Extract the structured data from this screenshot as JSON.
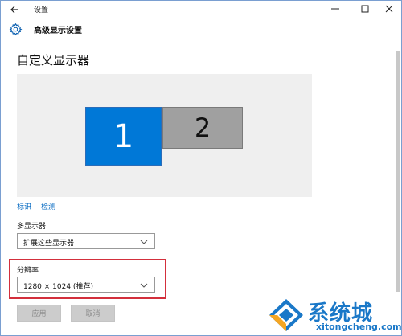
{
  "window": {
    "title": "设置",
    "icons": {
      "back": "back-arrow-icon",
      "minimize": "minimize-icon",
      "maximize": "maximize-icon",
      "close": "close-icon"
    }
  },
  "header": {
    "icon": "gear-icon",
    "title": "高级显示设置"
  },
  "page": {
    "title": "自定义显示器"
  },
  "displays": {
    "monitors": [
      {
        "label": "1",
        "selected": true,
        "color": "#0078d7"
      },
      {
        "label": "2",
        "selected": false,
        "color": "#a0a0a0"
      }
    ],
    "links": {
      "identify": "标识",
      "detect": "检测"
    }
  },
  "multiple_displays": {
    "label": "多显示器",
    "value": "扩展这些显示器"
  },
  "resolution": {
    "label": "分辨率",
    "value": "1280 × 1024 (推荐)",
    "highlight_color": "#d32f3c"
  },
  "buttons": {
    "apply": "应用",
    "cancel": "取消"
  },
  "watermark": {
    "text_cn": "系统城",
    "text_en": "xitongcheng.com",
    "color": "#1a78c8"
  }
}
